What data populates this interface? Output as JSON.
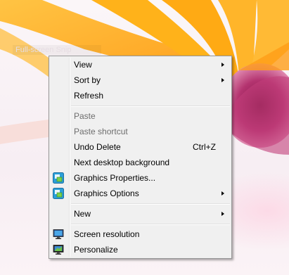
{
  "snip_label": "Full-screen Snip",
  "menu": {
    "items": [
      {
        "label": "View",
        "submenu": true
      },
      {
        "label": "Sort by",
        "submenu": true
      },
      {
        "label": "Refresh"
      },
      {
        "label": "Paste",
        "disabled": true
      },
      {
        "label": "Paste shortcut",
        "disabled": true
      },
      {
        "label": "Undo Delete",
        "shortcut": "Ctrl+Z"
      },
      {
        "label": "Next desktop background"
      },
      {
        "label": "Graphics Properties...",
        "icon": "graphics-icon"
      },
      {
        "label": "Graphics Options",
        "icon": "graphics-icon",
        "submenu": true
      },
      {
        "label": "New",
        "submenu": true
      },
      {
        "label": "Screen resolution",
        "icon": "monitor-icon"
      },
      {
        "label": "Personalize",
        "icon": "personalize-icon"
      }
    ]
  },
  "colors": {
    "menu_bg": "#f0f0f0",
    "disabled_text": "#6d6d6d",
    "petal": "#ffb21a",
    "flower_center": "#b0306a"
  }
}
